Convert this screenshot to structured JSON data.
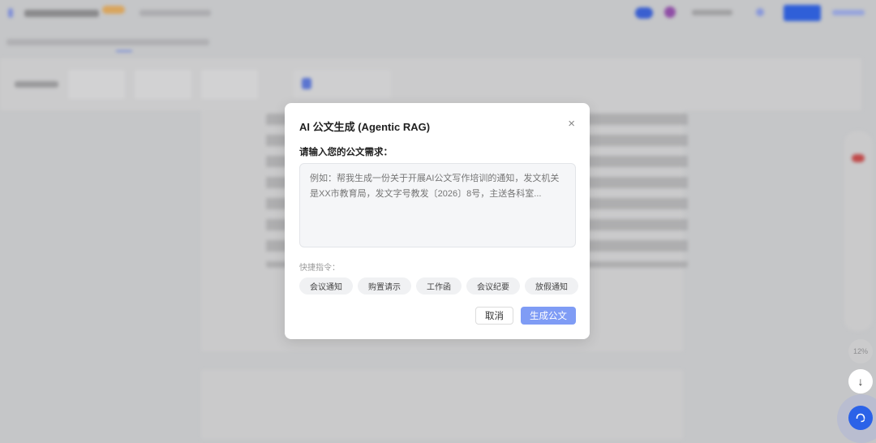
{
  "dialog": {
    "title": "AI 公文生成 (Agentic RAG)",
    "close_icon": "×",
    "prompt_label": "请输入您的公文需求：",
    "textarea_placeholder": "例如：帮我生成一份关于开展AI公文写作培训的通知，发文机关是XX市教育局，发文字号教发〔2026〕8号，主送各科室...",
    "textarea_value": "",
    "quick_label": "快捷指令：",
    "quick_commands": [
      "会议通知",
      "购置请示",
      "工作函",
      "会议纪要",
      "放假通知"
    ],
    "cancel_label": "取消",
    "generate_label": "生成公文"
  },
  "background": {
    "progress_label": "12%",
    "down_icon": "↓",
    "help_icon": "headset"
  },
  "colors": {
    "accent": "#2b62e8",
    "generate_button": "#7f9cf5"
  }
}
